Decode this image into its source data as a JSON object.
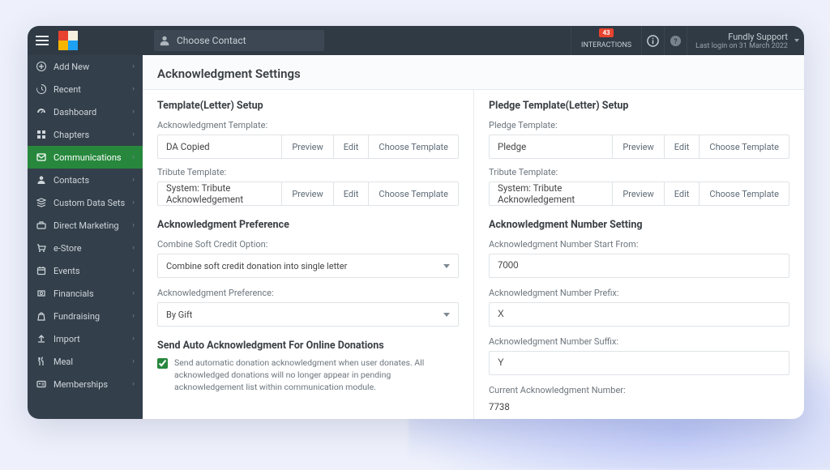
{
  "topbar": {
    "choose_contact": "Choose Contact",
    "interactions_label": "INTERACTIONS",
    "interactions_badge": "43",
    "support_name": "Fundly Support",
    "support_last_login": "Last login on 31 March 2022"
  },
  "sidebar": {
    "items": [
      {
        "label": "Add New",
        "icon": "plus"
      },
      {
        "label": "Recent",
        "icon": "history"
      },
      {
        "label": "Dashboard",
        "icon": "gauge"
      },
      {
        "label": "Chapters",
        "icon": "grid"
      },
      {
        "label": "Communications",
        "icon": "mail",
        "active": true
      },
      {
        "label": "Contacts",
        "icon": "person"
      },
      {
        "label": "Custom Data Sets",
        "icon": "stack"
      },
      {
        "label": "Direct Marketing",
        "icon": "briefcase"
      },
      {
        "label": "e-Store",
        "icon": "cart"
      },
      {
        "label": "Events",
        "icon": "calendar"
      },
      {
        "label": "Financials",
        "icon": "money"
      },
      {
        "label": "Fundraising",
        "icon": "bag"
      },
      {
        "label": "Import",
        "icon": "upload"
      },
      {
        "label": "Meal",
        "icon": "meal"
      },
      {
        "label": "Memberships",
        "icon": "idcard"
      }
    ]
  },
  "page": {
    "title": "Acknowledgment Settings",
    "left": {
      "template_setup_heading": "Template(Letter) Setup",
      "ack_template_label": "Acknowledgment Template:",
      "ack_template_value": "DA Copied",
      "tribute_template_label": "Tribute Template:",
      "tribute_template_value": "System: Tribute Acknowledgement",
      "pref_heading": "Acknowledgment Preference",
      "combine_label": "Combine Soft Credit Option:",
      "combine_value": "Combine soft credit donation into single letter",
      "pref_label": "Acknowledgment Preference:",
      "pref_value": "By Gift",
      "auto_heading": "Send Auto Acknowledgment For Online Donations",
      "auto_text": "Send automatic donation acknowledgment when user donates. All acknowledged donations will no longer appear in pending acknowledgement list within communication module."
    },
    "right": {
      "pledge_setup_heading": "Pledge Template(Letter) Setup",
      "pledge_template_label": "Pledge Template:",
      "pledge_template_value": "Pledge",
      "tribute_template_label": "Tribute Template:",
      "tribute_template_value": "System: Tribute Acknowledgement",
      "num_heading": "Acknowledgment Number Setting",
      "num_start_label": "Acknowledgment Number Start From:",
      "num_start_value": "7000",
      "num_prefix_label": "Acknowledgment Number Prefix:",
      "num_prefix_value": "X",
      "num_suffix_label": "Acknowledgment Number Suffix:",
      "num_suffix_value": "Y",
      "num_current_label": "Current Acknowledgment Number:",
      "num_current_value": "7738"
    },
    "buttons": {
      "preview": "Preview",
      "edit": "Edit",
      "choose": "Choose Template"
    }
  }
}
